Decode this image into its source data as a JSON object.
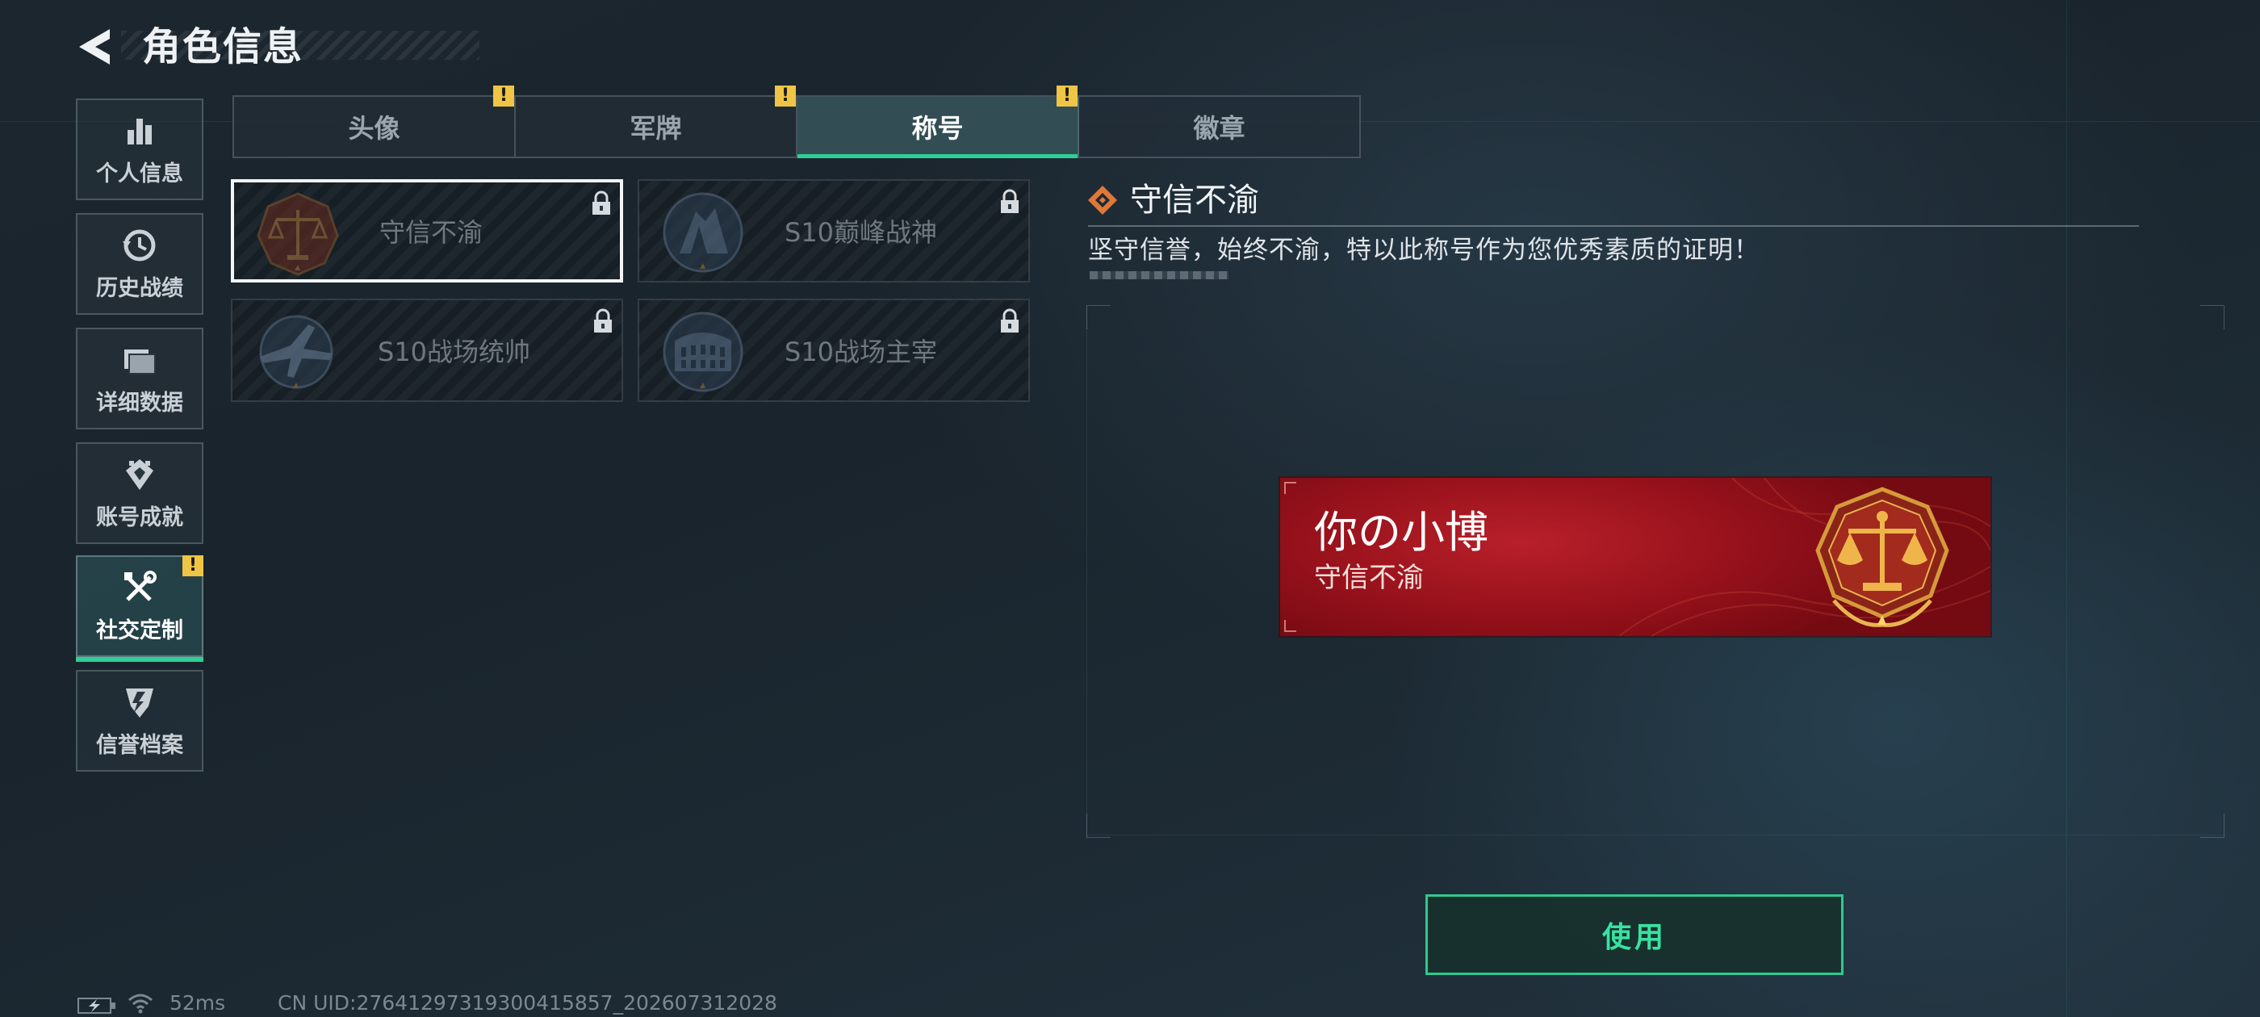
{
  "header": {
    "title": "角色信息"
  },
  "sidebar": {
    "items": [
      {
        "label": "个人信息",
        "icon": "bar-chart-icon"
      },
      {
        "label": "历史战绩",
        "icon": "history-icon"
      },
      {
        "label": "详细数据",
        "icon": "folder-icon"
      },
      {
        "label": "账号成就",
        "icon": "achievement-icon"
      },
      {
        "label": "社交定制",
        "icon": "tools-icon",
        "active": true,
        "badge": "!"
      },
      {
        "label": "信誉档案",
        "icon": "shield-icon"
      }
    ]
  },
  "tabs": [
    {
      "label": "头像",
      "badge": "!"
    },
    {
      "label": "军牌",
      "badge": "!"
    },
    {
      "label": "称号",
      "badge": "!",
      "active": true
    },
    {
      "label": "徽章"
    }
  ],
  "titles": [
    {
      "label": "守信不渝",
      "emblem": "scales-emblem",
      "selected": true,
      "locked": true
    },
    {
      "label": "S10巅峰战神",
      "emblem": "peak-emblem",
      "locked": true
    },
    {
      "label": "S10战场统帅",
      "emblem": "aircraft-emblem",
      "locked": true
    },
    {
      "label": "S10战场主宰",
      "emblem": "colosseum-emblem",
      "locked": true
    }
  ],
  "detail": {
    "title": "守信不渝",
    "description": "坚守信誉，始终不渝，特以此称号作为您优秀素质的证明！"
  },
  "nameplate": {
    "player_name": "你の小博",
    "title": "守信不渝"
  },
  "use_button": {
    "label": "使用"
  },
  "status": {
    "ping": "52ms",
    "uid": "CN UID:27641297319300415857_202607312028"
  },
  "colors": {
    "accent": "#2fcf95",
    "warn": "#f0c545",
    "nameplate_red": "#96111b",
    "emblem_gold": "#d59a3a"
  }
}
